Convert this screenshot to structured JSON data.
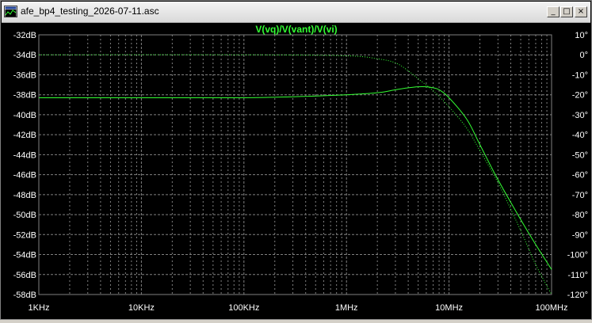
{
  "window": {
    "title": "afe_bp4_testing_2026-07-11.asc",
    "buttons": {
      "minimize": "_",
      "maximize": "□",
      "close": "×"
    }
  },
  "colors": {
    "background": "#000000",
    "grid": "#808080",
    "axis_text": "#ffffff",
    "trace": "#33ff33"
  },
  "chart_data": {
    "type": "line",
    "title": "V(vq)/V(vant)/V(vi)",
    "x_scale": "log",
    "x_unit": "Hz",
    "xlim": [
      1000,
      100000000
    ],
    "x_ticks": [
      "1KHz",
      "10KHz",
      "100KHz",
      "1MHz",
      "10MHz",
      "100MHz"
    ],
    "ylim_left": [
      -58,
      -32
    ],
    "y_ticks_left": [
      "-32dB",
      "-34dB",
      "-36dB",
      "-38dB",
      "-40dB",
      "-42dB",
      "-44dB",
      "-46dB",
      "-48dB",
      "-50dB",
      "-52dB",
      "-54dB",
      "-56dB",
      "-58dB"
    ],
    "ylim_right": [
      -120,
      10
    ],
    "y_ticks_right": [
      "10°",
      "0°",
      "-10°",
      "-20°",
      "-30°",
      "-40°",
      "-50°",
      "-60°",
      "-70°",
      "-80°",
      "-90°",
      "-100°",
      "-110°",
      "-120°"
    ],
    "grid": true,
    "series": [
      {
        "style": "solid",
        "axis": "left",
        "x": [
          1000,
          10000,
          100000,
          300000,
          1000000,
          2000000,
          3000000,
          4000000,
          5000000,
          6000000,
          7000000,
          8000000,
          10000000,
          15000000,
          20000000,
          30000000,
          50000000,
          70000000,
          100000000
        ],
        "y": [
          -38.3,
          -38.3,
          -38.3,
          -38.2,
          -38.0,
          -37.8,
          -37.5,
          -37.3,
          -37.2,
          -37.2,
          -37.3,
          -37.5,
          -38.3,
          -40.5,
          -43.0,
          -46.5,
          -50.5,
          -53.0,
          -55.5
        ]
      },
      {
        "style": "dotted",
        "axis": "right",
        "x": [
          1000,
          100000,
          1000000,
          2000000,
          3000000,
          4000000,
          5000000,
          7000000,
          10000000,
          15000000,
          20000000,
          30000000,
          50000000,
          70000000,
          100000000
        ],
        "y": [
          0,
          0,
          -0.5,
          -2,
          -4,
          -8,
          -12,
          -18,
          -26,
          -37,
          -48,
          -64,
          -88,
          -105,
          -120
        ]
      }
    ]
  }
}
